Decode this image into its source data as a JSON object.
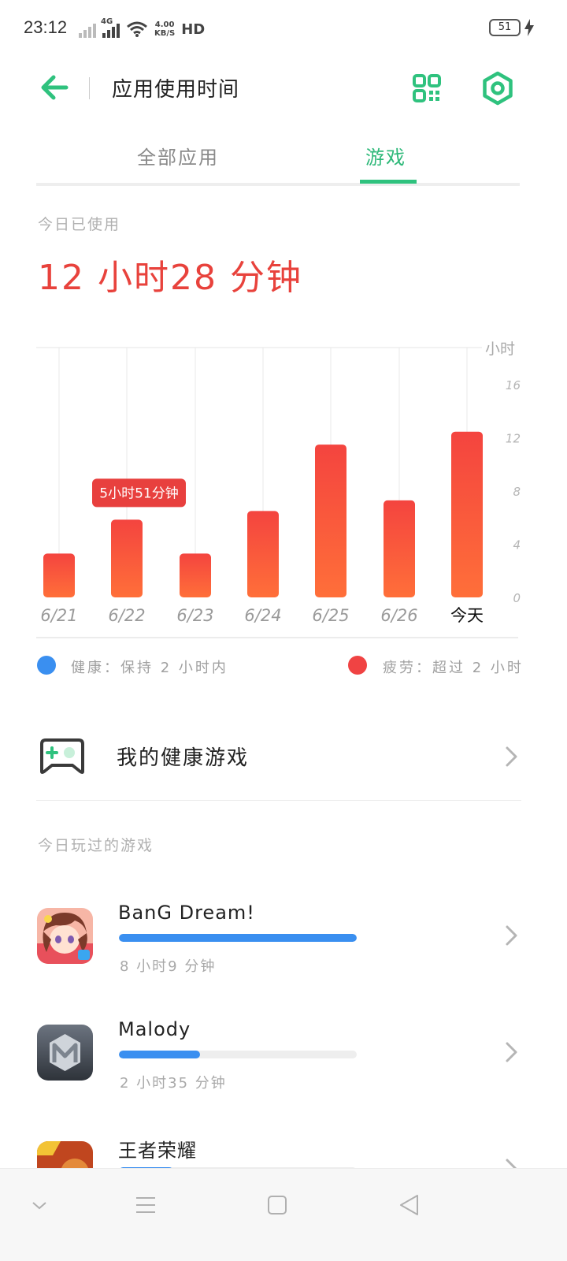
{
  "status_bar": {
    "time": "23:12",
    "network_type": "4G",
    "speed_value": "4.00",
    "speed_unit": "KB/S",
    "hd_label": "HD",
    "battery": "51"
  },
  "header": {
    "title": "应用使用时间",
    "icons": [
      "back-arrow-icon",
      "qr-code-icon",
      "settings-icon"
    ],
    "accent_color": "#2fc27e"
  },
  "tabs": [
    {
      "label": "全部应用",
      "active": false
    },
    {
      "label": "游戏",
      "active": true
    }
  ],
  "usage": {
    "today_label": "今日已使用",
    "today_value": "12 小时28 分钟",
    "value_color": "#e8423c"
  },
  "chart_data": {
    "type": "bar",
    "categories": [
      "6/21",
      "6/22",
      "6/23",
      "6/24",
      "6/25",
      "6/26",
      "今天"
    ],
    "values": [
      3.3,
      5.85,
      3.3,
      6.5,
      11.5,
      7.3,
      12.47
    ],
    "y_unit_label": "小时",
    "y_ticks": [
      "16",
      "12",
      "8",
      "4",
      "0"
    ],
    "ylim": [
      0,
      18.8
    ],
    "tooltip": {
      "category_index": 1,
      "text": "5小时51分钟"
    },
    "bar_color_top": "#f4443f",
    "bar_color_bottom": "#ff6f39",
    "grid": true
  },
  "legend": {
    "healthy": {
      "text": "健康：保持 2 小时内",
      "color": "#3a8ff0"
    },
    "tired": {
      "text": "疲劳：超过 2 小时",
      "color": "#f04343"
    }
  },
  "healthy_games": {
    "label": "我的健康游戏",
    "icon": "gamepad-icon"
  },
  "played_today": {
    "label": "今日玩过的游戏",
    "games": [
      {
        "name": "BanG Dream!",
        "time": "8 小时9 分钟",
        "progress": 1.0,
        "icon": "bang-dream-app-icon"
      },
      {
        "name": "Malody",
        "time": "2 小时35 分钟",
        "progress": 0.34,
        "icon": "malody-app-icon"
      },
      {
        "name": "王者荣耀",
        "time": "",
        "progress": 0.23,
        "icon": "honor-of-kings-app-icon"
      }
    ]
  },
  "navbar": {
    "icons": [
      "chevron-down-icon",
      "menu-icon",
      "home-icon",
      "back-triangle-icon"
    ]
  }
}
